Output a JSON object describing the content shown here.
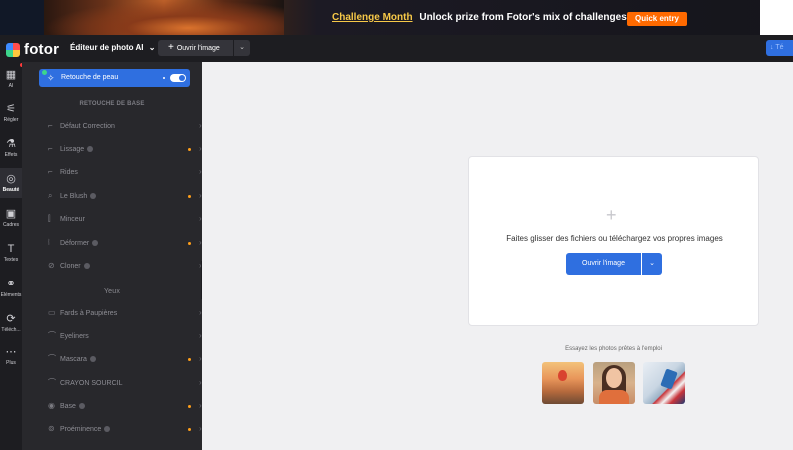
{
  "banner": {
    "highlight": "Challenge Month",
    "message": "Unlock prize from Fotor's mix of challenges",
    "cta": "Quick entry"
  },
  "topbar": {
    "logo_text": "fotor",
    "editor_label": "Éditeur de photo AI",
    "editor_chevron": "⌄",
    "open_label": "Ouvrir l'image",
    "open_caret": "⌄",
    "download_label": "Té"
  },
  "rail": {
    "items": [
      {
        "icon": "▦",
        "label": "AI"
      },
      {
        "icon": "⚟",
        "label": "Régler"
      },
      {
        "icon": "⚗",
        "label": "Effets"
      },
      {
        "icon": "◎",
        "label": "Beauté"
      },
      {
        "icon": "▣",
        "label": "Cadres"
      },
      {
        "icon": "T",
        "label": "Textes"
      },
      {
        "icon": "⚭",
        "label": "Éléments"
      },
      {
        "icon": "⟳",
        "label": "Téléch..."
      },
      {
        "icon": "⋯",
        "label": "Plus"
      }
    ]
  },
  "panel": {
    "skin": {
      "label": "Retouche de peau"
    },
    "section_basic": "RETOUCHE DE BASE",
    "basic_items": [
      {
        "icon": "⌐",
        "label": "Défaut Correction",
        "dot": false
      },
      {
        "icon": "⌐",
        "label": "Lissage",
        "dot": true
      },
      {
        "icon": "⌐",
        "label": "Rides",
        "dot": false
      },
      {
        "icon": "⌕",
        "label": "Le Blush",
        "dot": true
      },
      {
        "icon": "⫿",
        "label": "Minceur",
        "dot": false
      },
      {
        "icon": "⦚",
        "label": "Déformer",
        "dot": true
      },
      {
        "icon": "⊘",
        "label": "Cloner",
        "dot": false
      }
    ],
    "section_eyes": "Yeux",
    "eye_items": [
      {
        "icon": "▭",
        "label": "Fards à Paupières",
        "dot": false
      },
      {
        "icon": "⌒",
        "label": "Eyeliners",
        "dot": false
      },
      {
        "icon": "⌒",
        "label": "Mascara",
        "dot": true
      },
      {
        "icon": "⌒",
        "label": "CRAYON SOURCIL",
        "dot": false
      },
      {
        "icon": "◉",
        "label": "Base",
        "dot": true
      },
      {
        "icon": "⊚",
        "label": "Proéminence",
        "dot": true
      }
    ],
    "chevron": "›",
    "collapse_icon": "‹"
  },
  "main": {
    "drop_text": "Faites glisser des fichiers ou téléchargez vos propres images",
    "plus_icon": "+",
    "open_button": "Ouvrir l'image",
    "open_caret": "⌄",
    "try_text": "Essayez les photos prêtes à l'emploi"
  }
}
